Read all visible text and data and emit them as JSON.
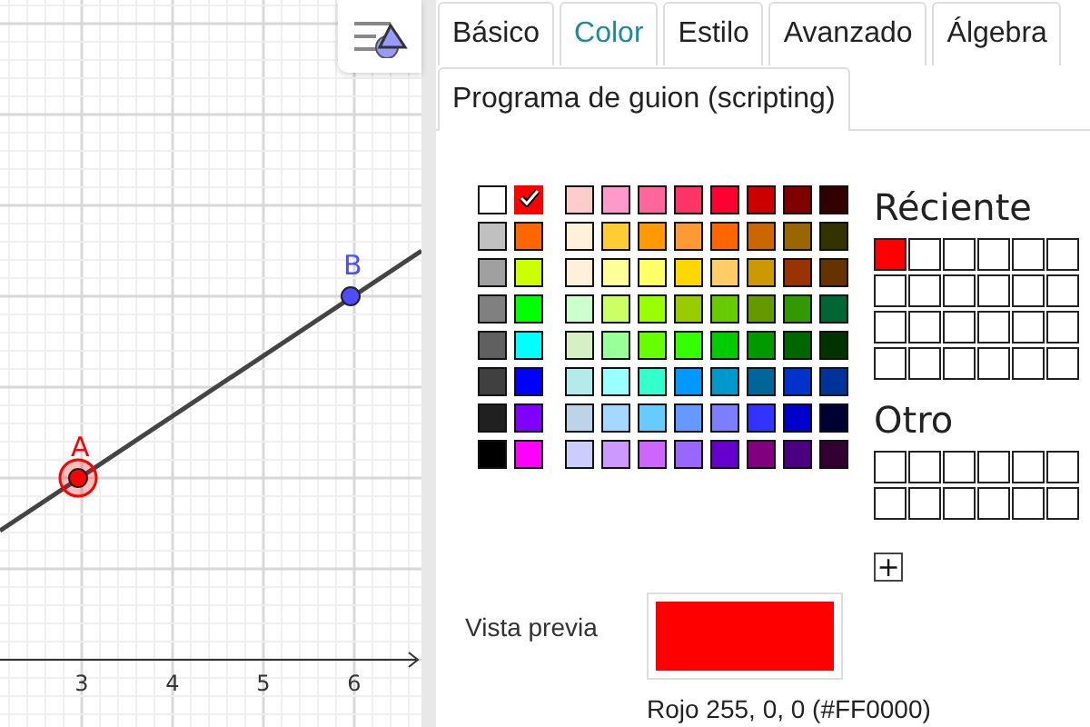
{
  "graphics": {
    "points": [
      {
        "label": "A",
        "color": "#ff0000",
        "selected": true
      },
      {
        "label": "B",
        "color": "#4d4dff",
        "selected": false
      }
    ],
    "x_ticks": [
      "3",
      "4",
      "5",
      "6"
    ]
  },
  "tabs": [
    {
      "label": "Básico",
      "selected": false
    },
    {
      "label": "Color",
      "selected": true
    },
    {
      "label": "Estilo",
      "selected": false
    },
    {
      "label": "Avanzado",
      "selected": false
    },
    {
      "label": "Álgebra",
      "selected": false
    },
    {
      "label": "Programa de guion (scripting)",
      "selected": false
    }
  ],
  "palette": {
    "side_columns": [
      [
        {
          "color": "#ffffff",
          "selected": false
        },
        {
          "color": "#c0c0c0",
          "selected": false
        },
        {
          "color": "#a0a0a0",
          "selected": false
        },
        {
          "color": "#808080",
          "selected": false
        },
        {
          "color": "#606060",
          "selected": false
        },
        {
          "color": "#404040",
          "selected": false
        },
        {
          "color": "#202020",
          "selected": false
        },
        {
          "color": "#000000",
          "selected": false
        }
      ],
      [
        {
          "color": "#ff0000",
          "selected": true
        },
        {
          "color": "#ff6600",
          "selected": false
        },
        {
          "color": "#ccff00",
          "selected": false
        },
        {
          "color": "#00ff00",
          "selected": false
        },
        {
          "color": "#00ffff",
          "selected": false
        },
        {
          "color": "#0000ff",
          "selected": false
        },
        {
          "color": "#8000ff",
          "selected": false
        },
        {
          "color": "#ff00ff",
          "selected": false
        }
      ]
    ],
    "grid_rows": [
      [
        {
          "color": "#ffcccc"
        },
        {
          "color": "#ff99cc"
        },
        {
          "color": "#ff6699"
        },
        {
          "color": "#ff3366"
        },
        {
          "color": "#ff0033"
        },
        {
          "color": "#cc0000"
        },
        {
          "color": "#800000"
        },
        {
          "color": "#330000"
        }
      ],
      [
        {
          "color": "#fff0d9"
        },
        {
          "color": "#ffcc33"
        },
        {
          "color": "#ff9900"
        },
        {
          "color": "#ff9933"
        },
        {
          "color": "#ff6600"
        },
        {
          "color": "#cc6600"
        },
        {
          "color": "#996600"
        },
        {
          "color": "#333300"
        }
      ],
      [
        {
          "color": "#fff0d9"
        },
        {
          "color": "#ffff99"
        },
        {
          "color": "#ffff66"
        },
        {
          "color": "#ffd700"
        },
        {
          "color": "#ffcc66"
        },
        {
          "color": "#cc9900"
        },
        {
          "color": "#993300"
        },
        {
          "color": "#663300"
        }
      ],
      [
        {
          "color": "#ccffcc"
        },
        {
          "color": "#ccff66"
        },
        {
          "color": "#99ff00"
        },
        {
          "color": "#99cc00"
        },
        {
          "color": "#66cc00"
        },
        {
          "color": "#669900"
        },
        {
          "color": "#339900"
        },
        {
          "color": "#006633"
        }
      ],
      [
        {
          "color": "#d5f0c5"
        },
        {
          "color": "#99ff99"
        },
        {
          "color": "#66ff00"
        },
        {
          "color": "#33ff00"
        },
        {
          "color": "#00cc00"
        },
        {
          "color": "#009900"
        },
        {
          "color": "#006600"
        },
        {
          "color": "#003300"
        }
      ],
      [
        {
          "color": "#b3eaea"
        },
        {
          "color": "#99ffff"
        },
        {
          "color": "#33ffcc"
        },
        {
          "color": "#0099ff"
        },
        {
          "color": "#0099cc"
        },
        {
          "color": "#006699"
        },
        {
          "color": "#0033cc"
        },
        {
          "color": "#003399"
        }
      ],
      [
        {
          "color": "#bcd3e8"
        },
        {
          "color": "#a5d8ff"
        },
        {
          "color": "#66ccff"
        },
        {
          "color": "#6699ff"
        },
        {
          "color": "#7d7dff"
        },
        {
          "color": "#3333ff"
        },
        {
          "color": "#0000cc"
        },
        {
          "color": "#000033"
        }
      ],
      [
        {
          "color": "#ccccff"
        },
        {
          "color": "#cc99ff"
        },
        {
          "color": "#cc66ff"
        },
        {
          "color": "#9966ff"
        },
        {
          "color": "#6600cc"
        },
        {
          "color": "#800080"
        },
        {
          "color": "#4b0082"
        },
        {
          "color": "#330033"
        }
      ]
    ]
  },
  "recent": {
    "title": "Réciente",
    "colors": [
      {
        "color": "#ff0000"
      }
    ]
  },
  "other": {
    "title": "Otro",
    "add_button": "+"
  },
  "preview": {
    "label": "Vista previa",
    "color": "#ff0000",
    "description": "Rojo 255, 0, 0 (#FF0000)"
  }
}
